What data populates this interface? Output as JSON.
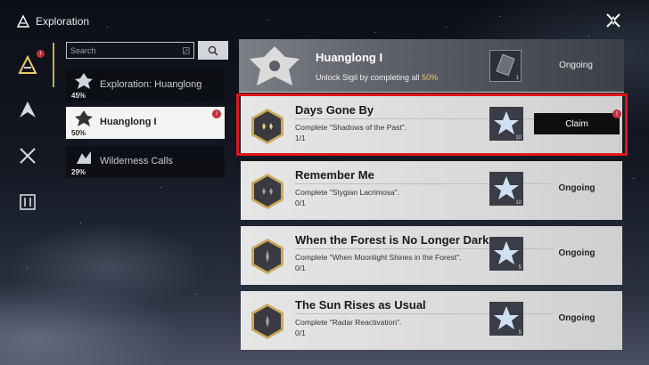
{
  "header": {
    "title": "Exploration"
  },
  "search": {
    "placeholder": "Search"
  },
  "categories": [
    {
      "name": "Exploration: Huanglong",
      "percent": "45%"
    },
    {
      "name": "Huanglong I",
      "percent": "50%",
      "alert": "!"
    },
    {
      "name": "Wilderness Calls",
      "percent": "29%"
    }
  ],
  "nav": {
    "badge": "!"
  },
  "summary": {
    "title": "Huanglong I",
    "subtitle_prefix": "Unlock Sigil by completing all",
    "subtitle_percent": "50%",
    "reward_count": "1",
    "status": "Ongoing"
  },
  "tasks": [
    {
      "title": "Days Gone By",
      "desc": "Complete \"Shadows of the Past\".",
      "progress": "1/1",
      "reward_count": "10",
      "status": "Claim",
      "alert": "!"
    },
    {
      "title": "Remember Me",
      "desc": "Complete \"Stygian Lacrimosa\".",
      "progress": "0/1",
      "reward_count": "10",
      "status": "Ongoing"
    },
    {
      "title": "When the Forest is No Longer Dark",
      "desc": "Complete \"When Moonlight Shines in the Forest\".",
      "progress": "0/1",
      "reward_count": "5",
      "status": "Ongoing"
    },
    {
      "title": "The Sun Rises as Usual",
      "desc": "Complete \"Radar Reactivation\".",
      "progress": "0/1",
      "reward_count": "5",
      "status": "Ongoing"
    }
  ],
  "colors": {
    "highlight": "#e0141c",
    "accent_gold": "#e4c567",
    "alert_red": "#c0303a"
  },
  "icons": {
    "header": "exploration-logo-icon",
    "close": "close-icon",
    "search": "search-icon",
    "nav": [
      "exploration-icon",
      "mountain-icon",
      "crossed-swords-icon",
      "sliders-icon"
    ]
  }
}
